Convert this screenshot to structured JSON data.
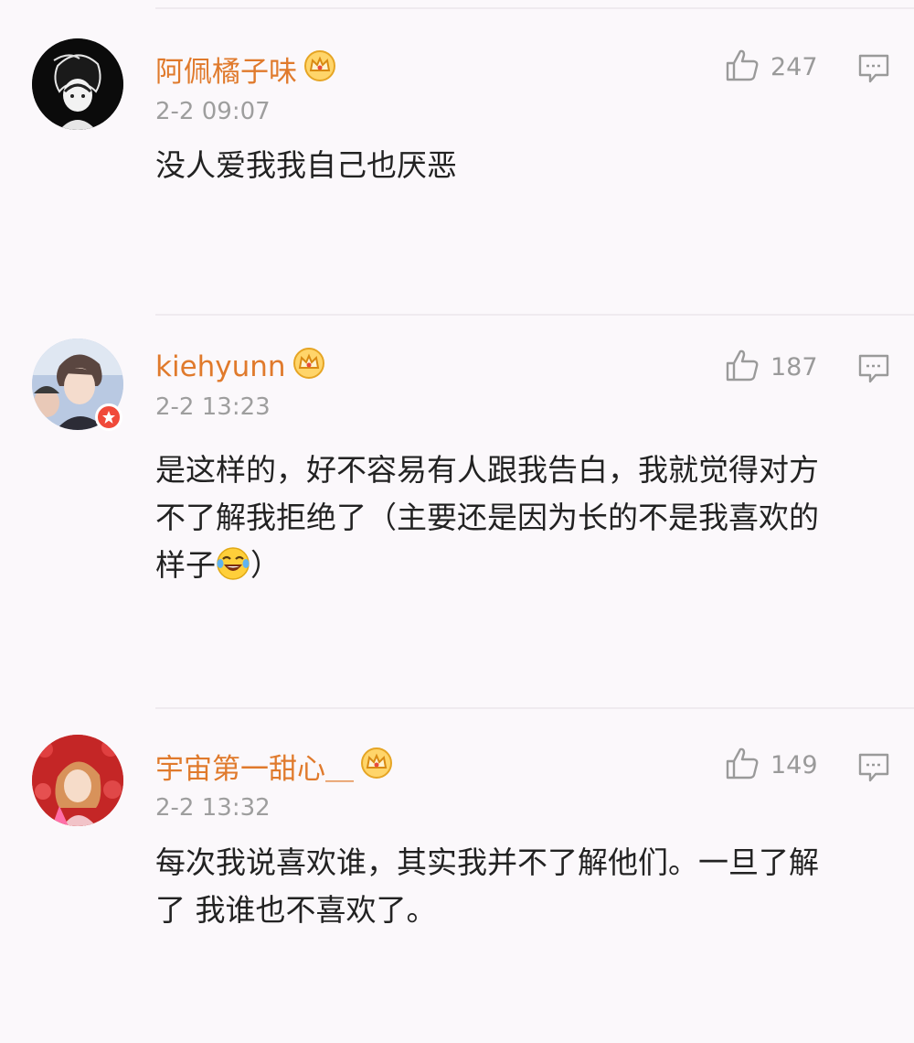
{
  "comments": [
    {
      "username": "阿佩橘子味",
      "time": "2-2 09:07",
      "likes": "247",
      "content": "没人爱我我自己也厌恶",
      "verified": false
    },
    {
      "username": "kiehyunn",
      "time": "2-2 13:23",
      "likes": "187",
      "content": "是这样的，好不容易有人跟我告白，我就觉得对方\n不了解我拒绝了（主要还是因为长的不是我喜欢的\n样子",
      "content_tail": "）",
      "emoji": "laugh-cry-emoji",
      "verified": true
    },
    {
      "username": "宇宙第一甜心＿",
      "time": "2-2 13:32",
      "likes": "149",
      "content": "每次我说喜欢谁，其实我并不了解他们。一旦了解\n了 我谁也不喜欢了。",
      "verified": false
    }
  ],
  "icons": {
    "like": "thumbs-up-icon",
    "reply": "comment-icon",
    "vip": "crown-icon"
  },
  "colors": {
    "username": "#e07a2c",
    "time": "#9e9e9e",
    "content": "#222222",
    "badge": "#f04a3a"
  }
}
